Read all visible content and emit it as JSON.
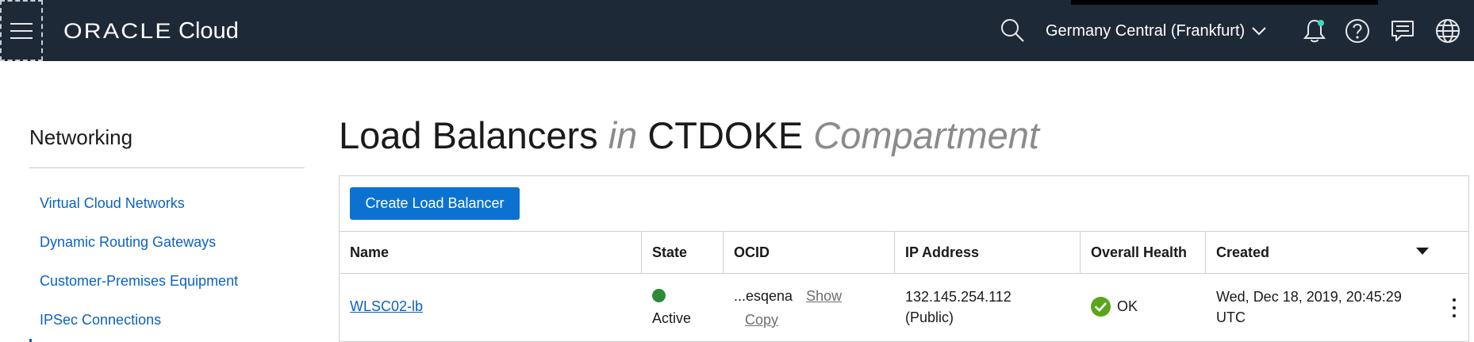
{
  "header": {
    "brand_oracle": "ORACLE",
    "brand_cloud": "Cloud",
    "region": "Germany Central (Frankfurt)",
    "icons": [
      "menu-icon",
      "search-icon",
      "chevron-down-icon",
      "bell-icon",
      "help-icon",
      "chat-icon",
      "globe-icon"
    ],
    "notification_color": "#3bd7c1"
  },
  "sidebar": {
    "title": "Networking",
    "items": [
      {
        "label": "Virtual Cloud Networks"
      },
      {
        "label": "Dynamic Routing Gateways"
      },
      {
        "label": "Customer-Premises Equipment"
      },
      {
        "label": "IPSec Connections"
      }
    ]
  },
  "main": {
    "title_part1": "Load Balancers",
    "title_in": "in",
    "title_compartment_name": "CTDOKE",
    "title_compartment_word": "Compartment",
    "create_button": "Create Load Balancer",
    "columns": [
      "Name",
      "State",
      "OCID",
      "IP Address",
      "Overall Health",
      "Created"
    ],
    "rows": [
      {
        "name": "WLSC02-lb",
        "state": "Active",
        "state_color": "#2e8a36",
        "ocid": "...esqena",
        "ocid_show": "Show",
        "ocid_copy": "Copy",
        "ip_line1": "132.145.254.112",
        "ip_line2": "(Public)",
        "health": "OK",
        "health_color": "#5aa51a",
        "created_line1": "Wed, Dec 18, 2019, 20:45:29",
        "created_line2": "UTC"
      }
    ]
  },
  "colors": {
    "header_bg": "#1e2938",
    "link": "#0b62c4",
    "primary_button": "#0b72d1"
  }
}
